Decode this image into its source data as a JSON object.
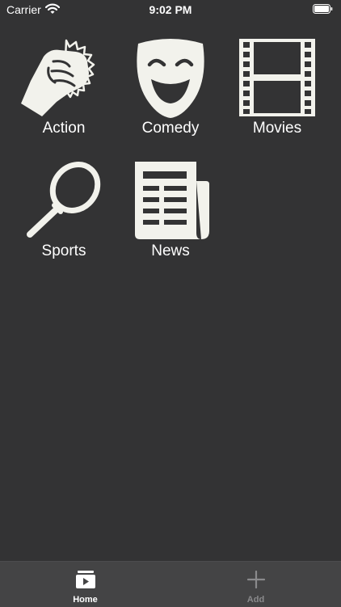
{
  "status_bar": {
    "carrier": "Carrier",
    "time": "9:02 PM",
    "wifi_icon": "wifi-icon",
    "battery_icon": "battery-icon"
  },
  "categories": [
    {
      "label": "Action",
      "icon": "fist-icon"
    },
    {
      "label": "Comedy",
      "icon": "comedy-mask-icon"
    },
    {
      "label": "Movies",
      "icon": "film-strip-icon"
    },
    {
      "label": "Sports",
      "icon": "tennis-racket-icon"
    },
    {
      "label": "News",
      "icon": "newspaper-icon"
    }
  ],
  "tab_bar": {
    "tabs": [
      {
        "label": "Home",
        "icon": "home-play-icon",
        "selected": true,
        "color": "#ffffff"
      },
      {
        "label": "Add",
        "icon": "plus-icon",
        "selected": false,
        "color": "#8a8a8c"
      }
    ]
  },
  "colors": {
    "background": "#333334",
    "tab_bar_background": "#444445",
    "icon": "#f2f2ec"
  }
}
